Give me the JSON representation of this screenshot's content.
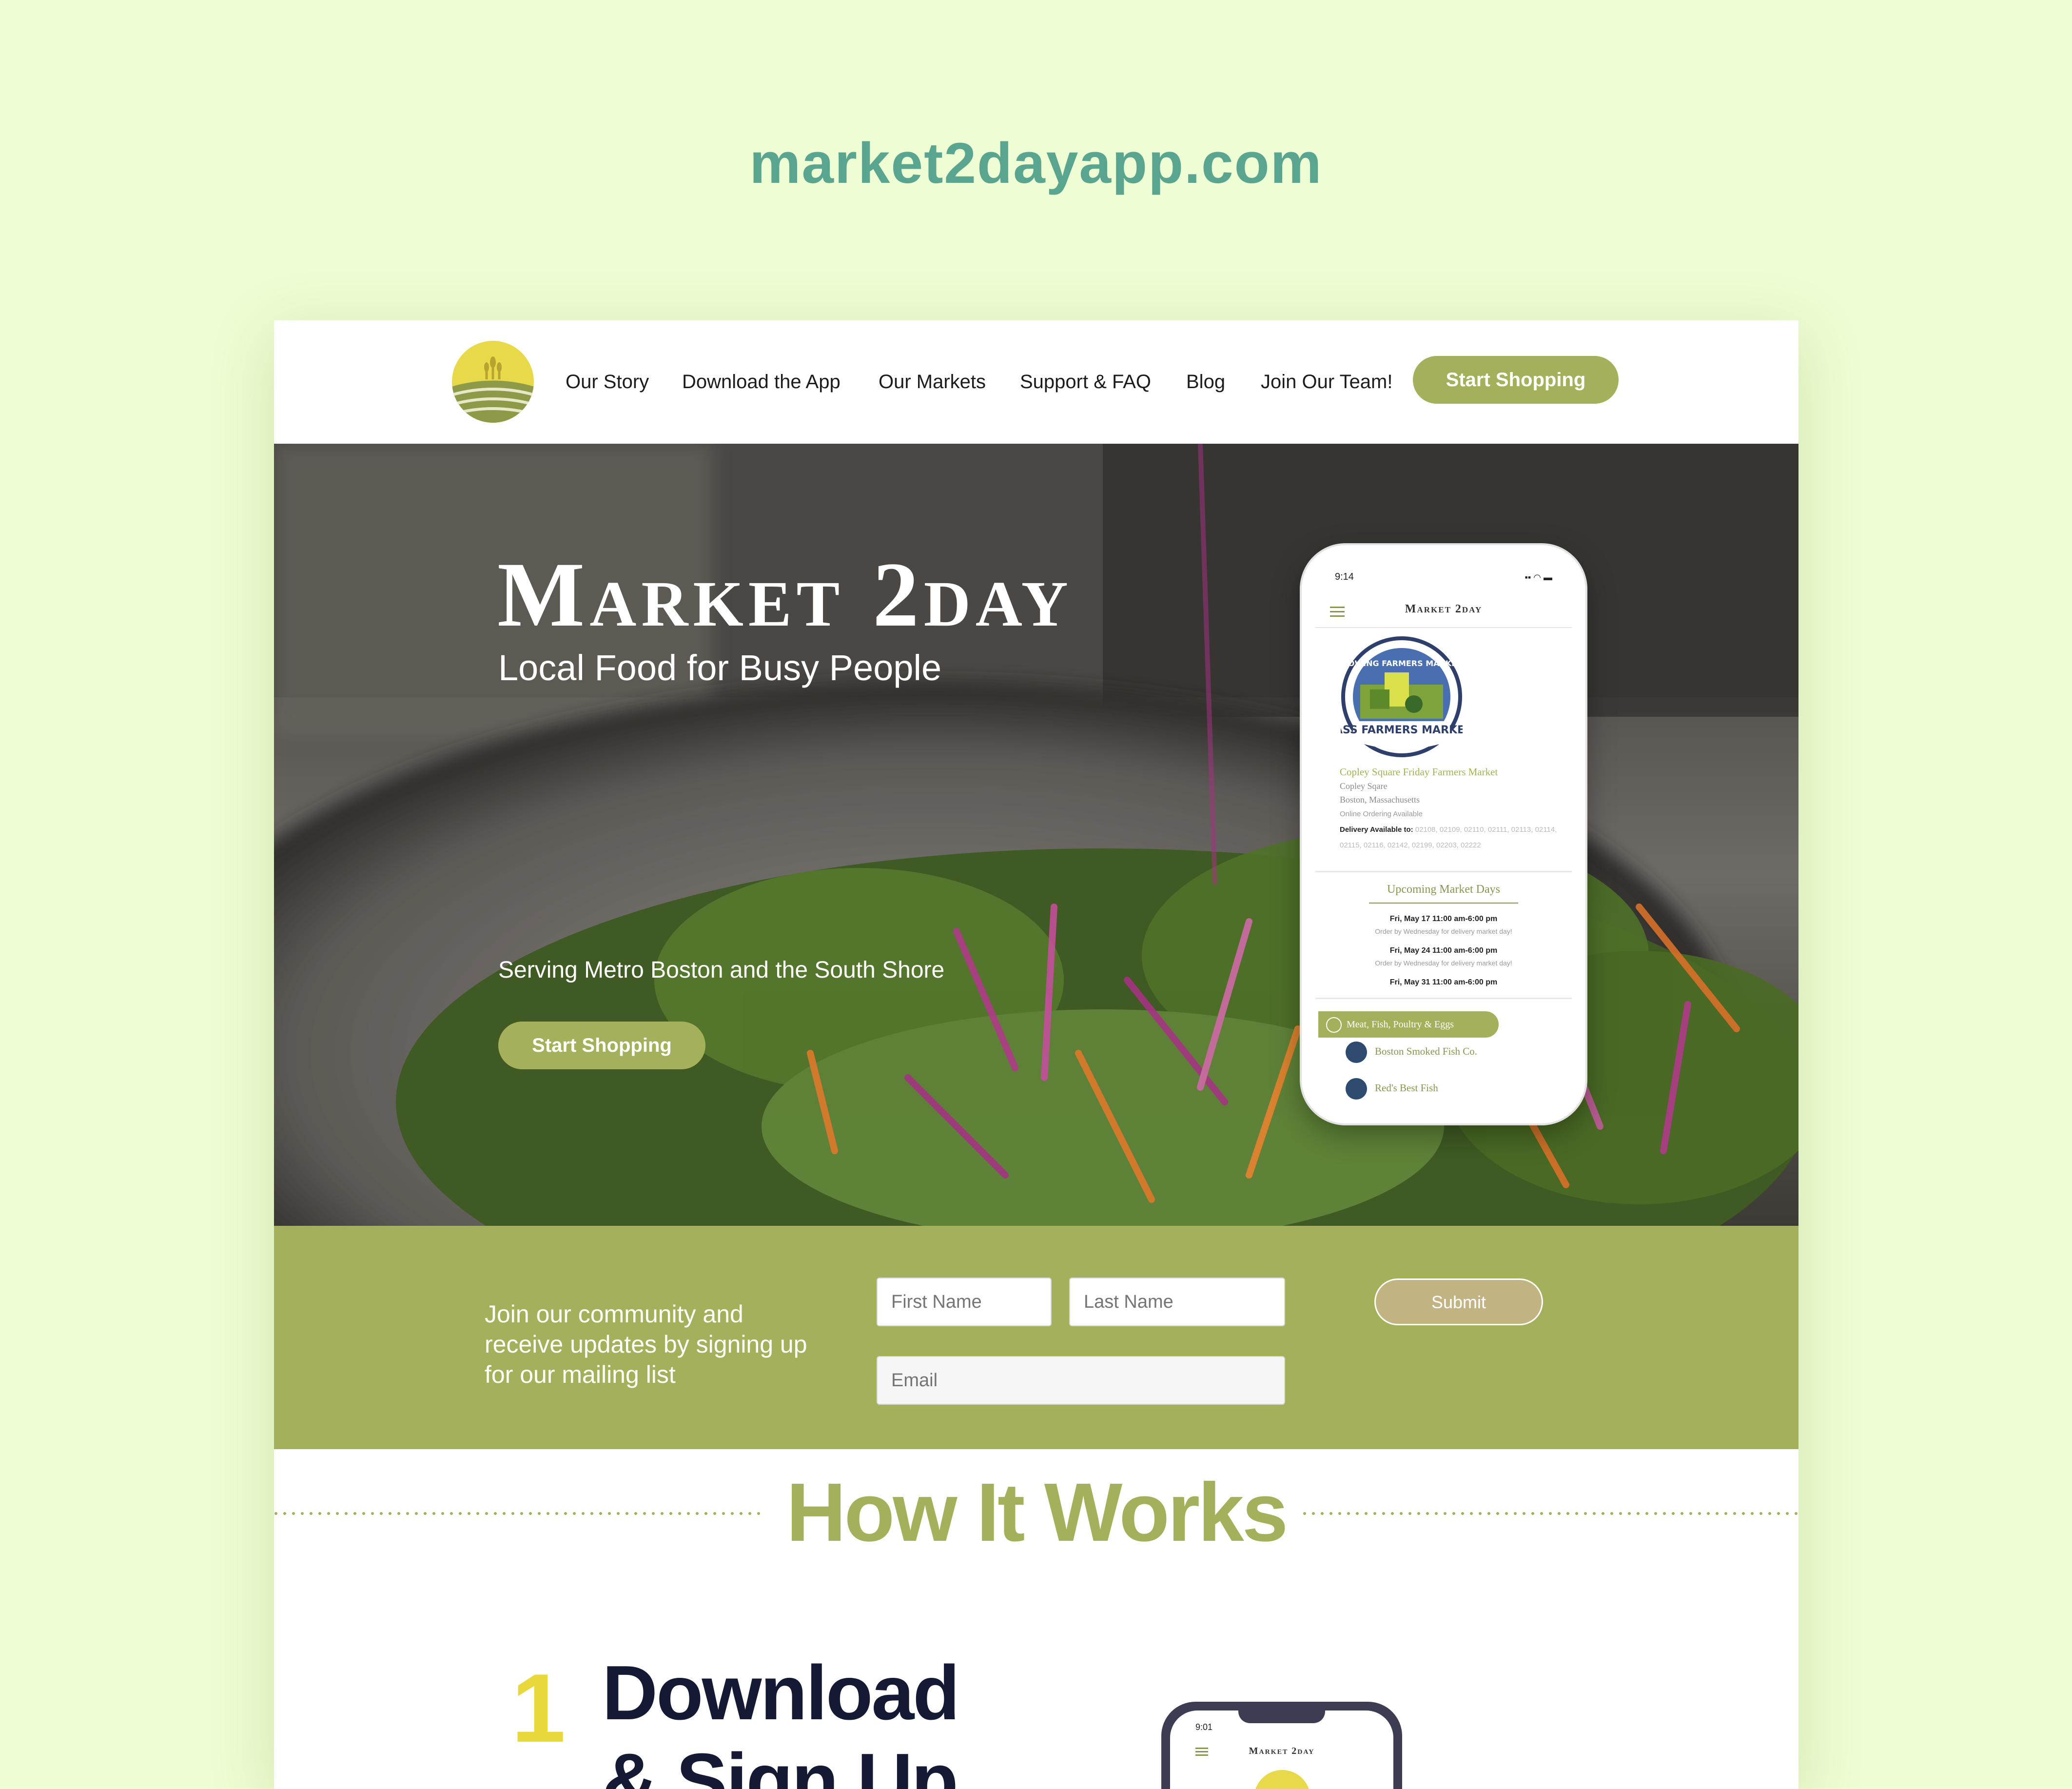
{
  "page_label": "market2dayapp.com",
  "header": {
    "nav": [
      "Our Story",
      "Download the App",
      "Our Markets",
      "Support & FAQ",
      "Blog",
      "Join Our Team!"
    ],
    "cta": "Start Shopping"
  },
  "hero": {
    "title": "Market 2day",
    "subtitle": "Local Food for Busy People",
    "tagline": "Serving Metro Boston and the South Shore",
    "cta": "Start Shopping"
  },
  "phone": {
    "time": "9:14",
    "brand": "Market 2day",
    "badge_top": "GROWING FARMERS MARKETS",
    "badge_bottom": "MASS FARMERS MARKETS",
    "market_name": "Copley Square Friday Farmers Market",
    "address_1": "Copley Sqare",
    "address_2": "Boston, Massachusetts",
    "ordering": "Online Ordering Available",
    "delivery_label": "Delivery Available to:",
    "delivery_zips": "02108, 02109, 02110, 02111, 02113, 02114, 02115, 02116, 02142, 02199, 02203, 02222",
    "upcoming_title": "Upcoming Market Days",
    "days": [
      {
        "date": "Fri, May 17 11:00 am-6:00 pm",
        "note": "Order by Wednesday for delivery market day!"
      },
      {
        "date": "Fri, May 24 11:00 am-6:00 pm",
        "note": "Order by Wednesday for delivery market day!"
      },
      {
        "date": "Fri, May 31 11:00 am-6:00 pm",
        "note": ""
      }
    ],
    "category": "Meat, Fish, Poultry & Eggs",
    "vendors": [
      "Boston Smoked Fish Co.",
      "Red's Best Fish"
    ]
  },
  "signup": {
    "text": "Join our community and receive updates by signing up for our mailing list",
    "first_name_placeholder": "First Name",
    "last_name_placeholder": "Last Name",
    "email_placeholder": "Email",
    "submit": "Submit"
  },
  "how": {
    "title": "How It Works",
    "step_number": "1",
    "step_title_1": "Download",
    "step_title_2": "& Sign Up"
  },
  "phone2": {
    "time": "9:01",
    "brand": "Market 2day"
  },
  "colors": {
    "background": "#eefdd3",
    "accent_green": "#a5b05a",
    "teal_label": "#5aa58f",
    "yellow": "#e8d83c",
    "navy": "#141a33",
    "submit_tan": "#c2b482"
  }
}
